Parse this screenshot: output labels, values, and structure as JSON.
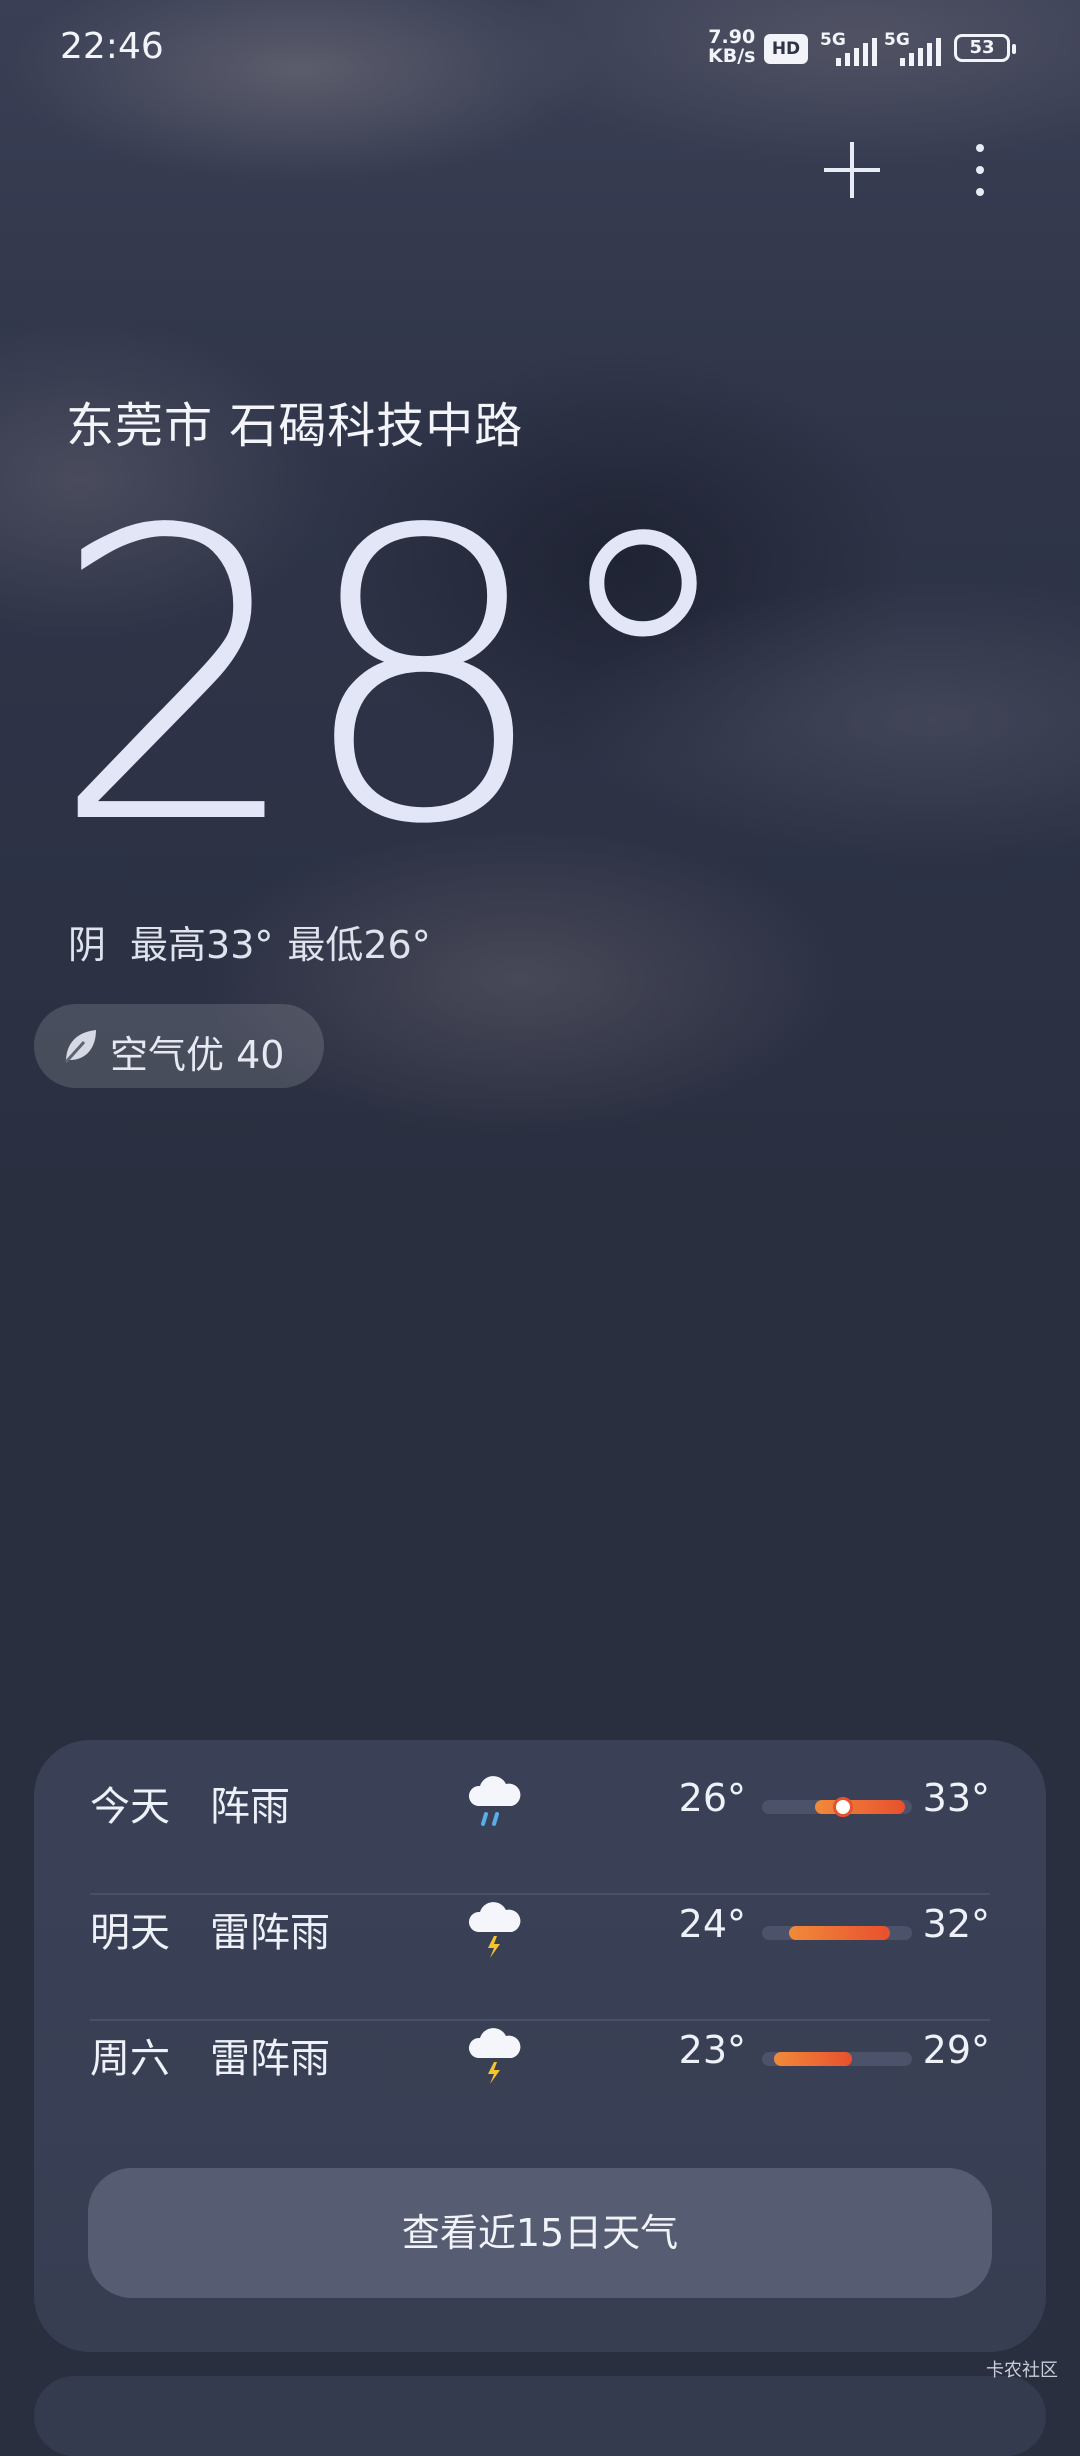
{
  "status_bar": {
    "time": "22:46",
    "net_speed_value": "7.90",
    "net_speed_unit": "KB/s",
    "hd_label": "HD",
    "sim1_label": "5G",
    "sim2_label": "5G",
    "battery": "53"
  },
  "header": {
    "add_icon": "plus-icon",
    "more_icon": "more-vertical-icon"
  },
  "location": "东莞市 石碣科技中路",
  "current": {
    "temperature": "28°",
    "condition": "阴",
    "high": "最高33°",
    "low": "最低26°"
  },
  "aqi": {
    "icon": "leaf-icon",
    "label": "空气优 40"
  },
  "forecast": [
    {
      "day": "今天",
      "desc": "阵雨",
      "icon": "shower-rain-icon",
      "low": "26°",
      "high": "33°",
      "bar_start": 0.35,
      "bar_end": 0.95,
      "now": 0.52
    },
    {
      "day": "明天",
      "desc": "雷阵雨",
      "icon": "thunderstorm-icon",
      "low": "24°",
      "high": "32°",
      "bar_start": 0.18,
      "bar_end": 0.85
    },
    {
      "day": "周六",
      "desc": "雷阵雨",
      "icon": "thunderstorm-icon",
      "low": "23°",
      "high": "29°",
      "bar_start": 0.08,
      "bar_end": 0.6
    }
  ],
  "forecast_button": "查看近15日天气",
  "watermark": "卡农社区",
  "colors": {
    "background": "#2a2f40",
    "card": "#3a4157",
    "accent_orange": "#e8502e",
    "rain_blue": "#5aaee8",
    "lightning_yellow": "#f5c531"
  }
}
